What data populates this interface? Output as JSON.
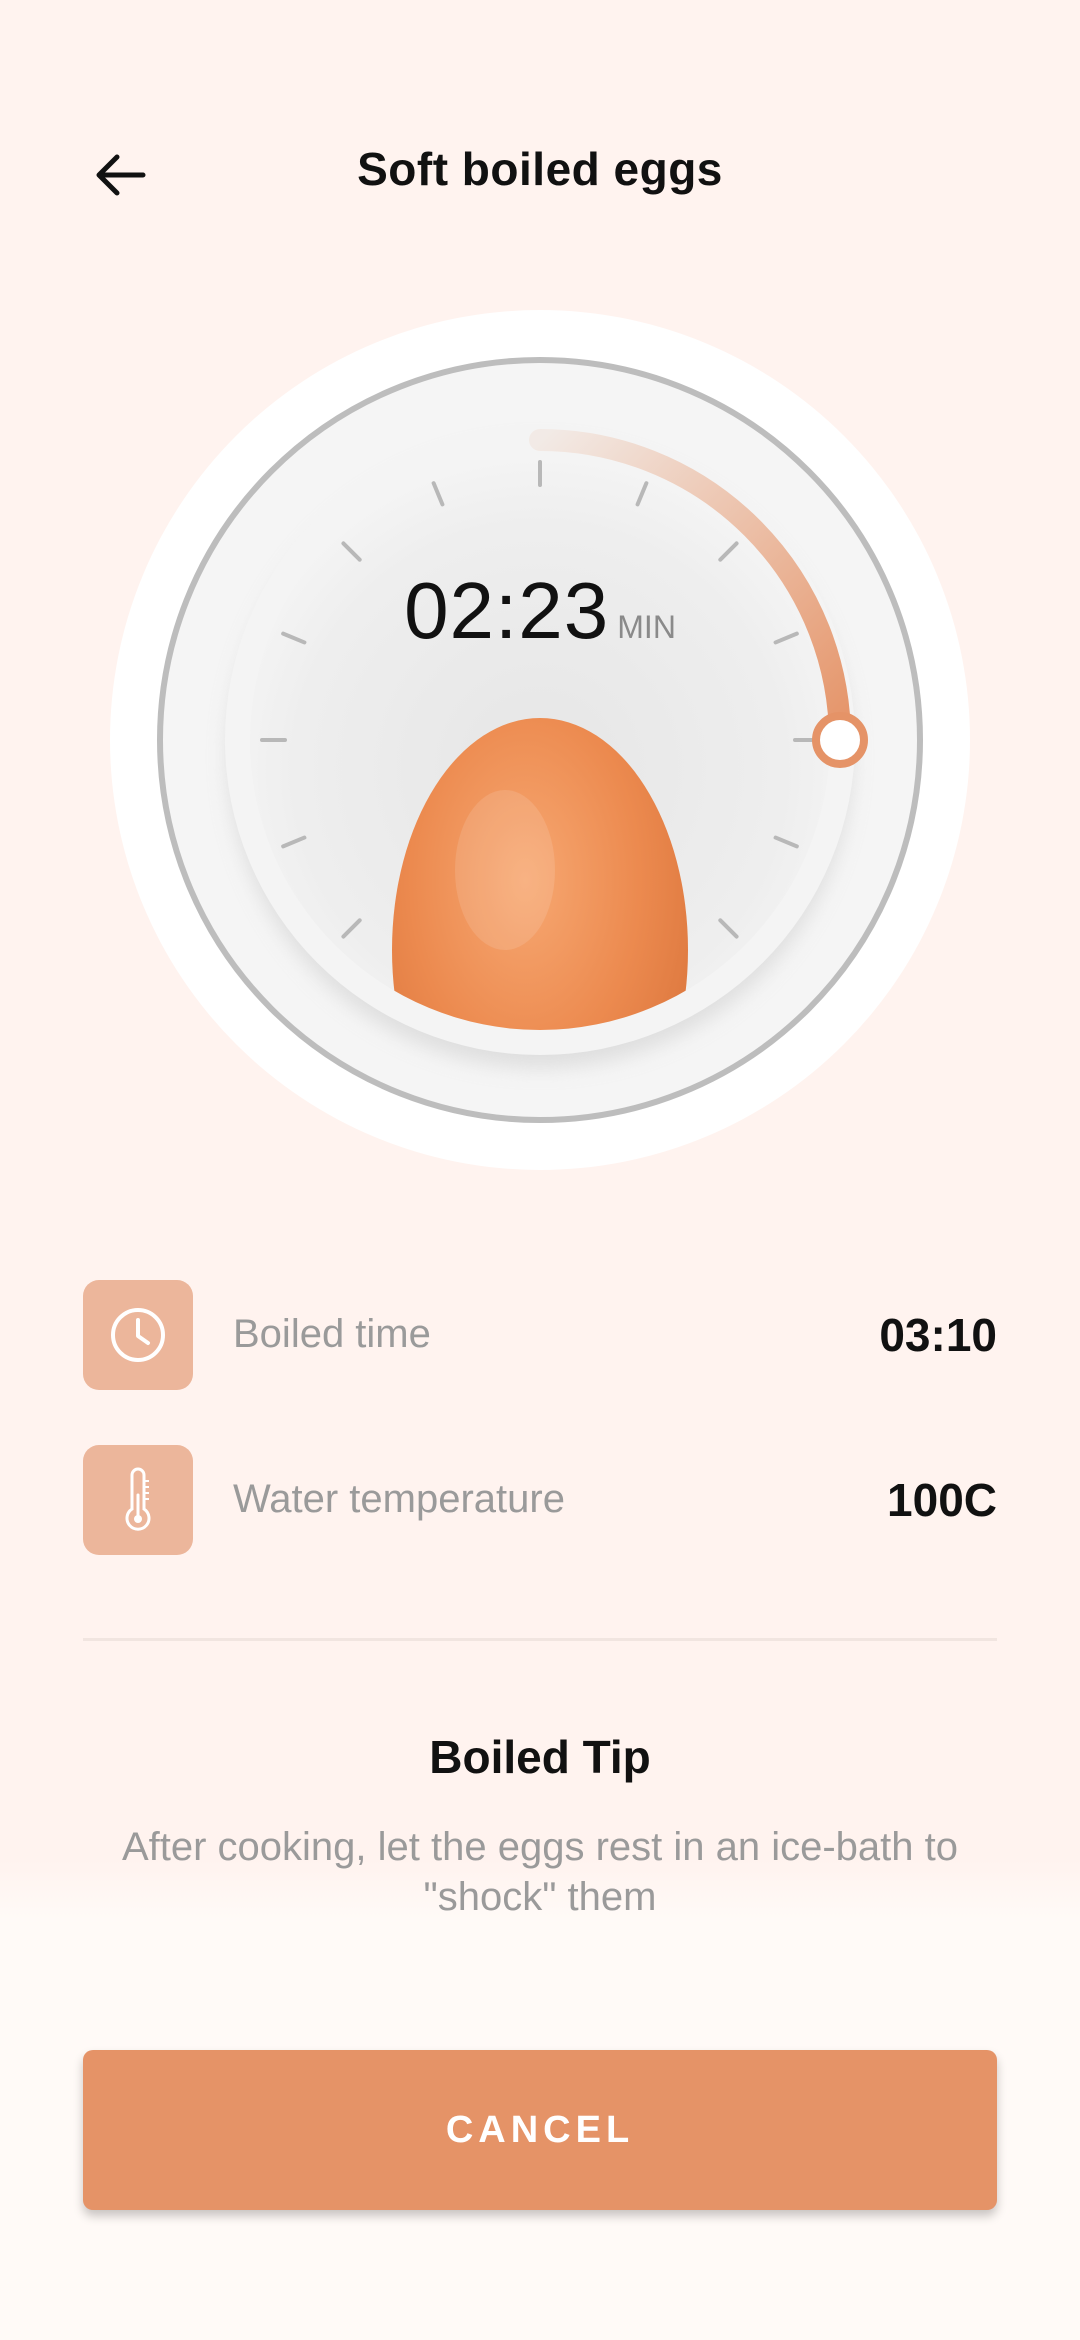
{
  "header": {
    "title": "Soft boiled eggs",
    "back_icon": "arrow-left-icon"
  },
  "timer": {
    "time": "02:23",
    "unit": "MIN",
    "progress": 0.25,
    "accent_color": "#e59367"
  },
  "info": {
    "boiled_time": {
      "icon": "clock-icon",
      "label": "Boiled time",
      "value": "03:10"
    },
    "water_temperature": {
      "icon": "thermometer-icon",
      "label": "Water temperature",
      "value": "100C"
    }
  },
  "tip": {
    "title": "Boiled Tip",
    "text": "After cooking, let the eggs rest in an ice-bath to \"shock\" them"
  },
  "actions": {
    "cancel_label": "CANCEL"
  },
  "colors": {
    "background": "#fff3ef",
    "accent": "#e59367",
    "icon_tile": "#ecb69b"
  }
}
